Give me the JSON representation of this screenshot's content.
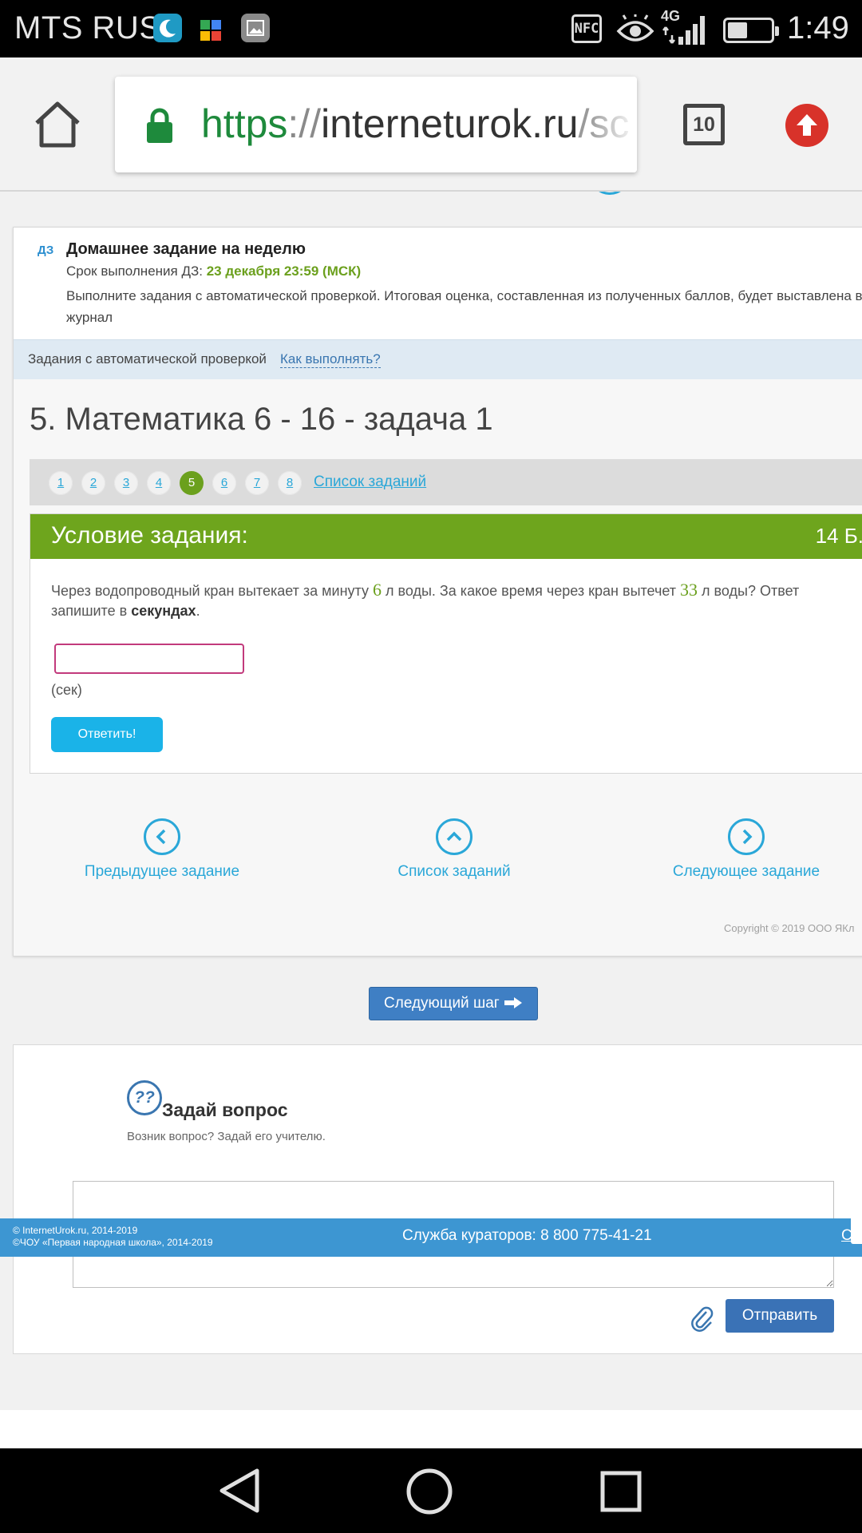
{
  "status_bar": {
    "carrier": "MTS RUS",
    "network": "4G",
    "nfc_label": "NFC",
    "time": "1:49",
    "icons": [
      "moon-app-icon",
      "puzzle-app-icon",
      "gallery-app-icon",
      "nfc-icon",
      "eye-icon",
      "signal-icon",
      "battery-icon"
    ]
  },
  "browser": {
    "url_scheme": "https",
    "url_sep": "://",
    "url_host": "interneturok.ru",
    "url_rest": "/sc",
    "tab_count": "10",
    "colors": {
      "secure": "#1e8a3c",
      "upload": "#d8322a"
    }
  },
  "homework": {
    "tag": "ДЗ",
    "title": "Домашнее задание на неделю",
    "deadline_label": "Срок выполнения ДЗ:",
    "deadline_value": "23 декабря 23:59 (МСК)",
    "description": "Выполните задания с автоматической проверкой. Итоговая оценка, составленная из полученных баллов, будет выставлена в журнал"
  },
  "auto_check": {
    "label": "Задания с автоматической проверкой",
    "how_link": "Как выполнять?"
  },
  "task": {
    "title": "5. Математика 6 - 16 - задача 1",
    "pages": [
      "1",
      "2",
      "3",
      "4",
      "5",
      "6",
      "7",
      "8"
    ],
    "active_page": "5",
    "list_link": "Список заданий"
  },
  "condition": {
    "header": "Условие задания:",
    "points": "14 Б.",
    "text_part1": "Через водопроводный кран вытекает за минуту",
    "num1": "6",
    "text_part2": "л воды. За какое время через кран вытечет",
    "num2": "33",
    "text_part3": "л воды? Ответ запишите в",
    "text_bold": "секундах",
    "text_end": ".",
    "answer_value": "",
    "unit": "(сек)",
    "answer_button": "Ответить!",
    "accent_color": "#6ea51d"
  },
  "task_nav": {
    "prev": "Предыдущее задание",
    "list": "Список заданий",
    "next": "Следующее задание"
  },
  "copyright": "Copyright © 2019 ООО ЯКл",
  "next_step_button": "Следующий шаг",
  "question": {
    "icon_text": "??",
    "title": "Задай вопрос",
    "subtitle": "Возник вопрос? Задай его учителю.",
    "text_value": "",
    "send_button": "Отправить"
  },
  "footer": {
    "copyright_line1": "© InternetUrok.ru, 2014-2019",
    "copyright_line2": "©ЧОУ «Первая народная школа», 2014-2019",
    "curators": "Служба кураторов: 8 800 775-41-21",
    "help": "Спр",
    "color": "#3d96d2"
  }
}
